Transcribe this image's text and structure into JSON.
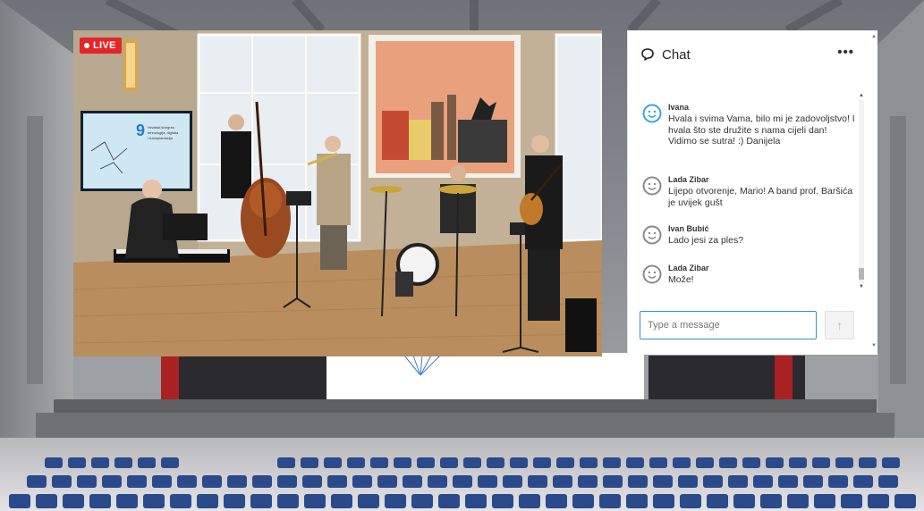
{
  "video": {
    "live_label": "LIVE",
    "screen": {
      "number": "9",
      "heading_lines": [
        "Hrvatski kongres",
        "tehnologija, digitala",
        "i transplantacija"
      ]
    }
  },
  "chat": {
    "title": "Chat",
    "menu_label": "•••",
    "messages": [
      {
        "name": "Ivana",
        "text": "Hvala i svima Vama, bilo mi je zadovoljstvo! I hvala što ste družite s nama cijeli dan! Vidimo se sutra! :) Danijela",
        "avatar": "smiley-blue"
      },
      {
        "name": "Lada Zibar",
        "text": "Lijepo otvorenje, Mario! A band prof. Baršića je uvijek gušt",
        "avatar": "smiley-gray"
      },
      {
        "name": "Ivan Bubić",
        "text": "Lado jesi za ples?",
        "avatar": "smiley-gray"
      },
      {
        "name": "Lada Zibar",
        "text": "Može!",
        "avatar": "smiley-gray"
      }
    ],
    "input": {
      "placeholder": "Type a message",
      "value": ""
    },
    "send_icon": "arrow-up-icon"
  },
  "colors": {
    "live_red": "#e3262a",
    "input_border_blue": "#2f8fe0",
    "avatar_blue": "#3aa0e8",
    "avatar_gray": "#8a8a8a",
    "backdrop_peach": "#e9a07c"
  }
}
